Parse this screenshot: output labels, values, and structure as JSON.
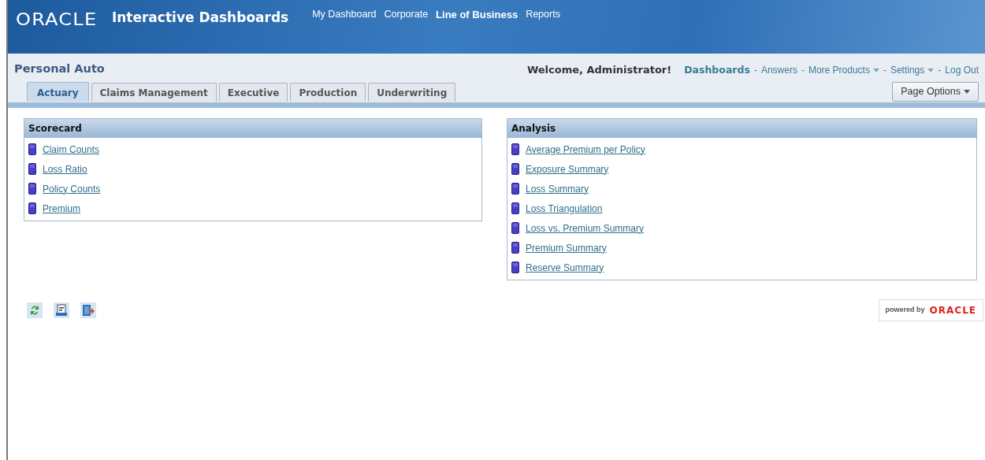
{
  "header": {
    "brand": "ORACLE",
    "app_title": "Interactive Dashboards",
    "nav": [
      {
        "label": "My Dashboard",
        "selected": false
      },
      {
        "label": "Corporate",
        "selected": false
      },
      {
        "label": "Line of Business",
        "selected": true
      },
      {
        "label": "Reports",
        "selected": false
      }
    ]
  },
  "page_title": "Personal Auto",
  "welcome": "Welcome, Administrator!",
  "global_links": [
    {
      "kind": "link",
      "label": "Dashboards",
      "selected": true,
      "has_menu": false
    },
    {
      "kind": "separator",
      "label": "-"
    },
    {
      "kind": "link",
      "label": "Answers",
      "selected": false,
      "has_menu": false
    },
    {
      "kind": "separator",
      "label": "-"
    },
    {
      "kind": "link",
      "label": "More Products",
      "selected": false,
      "has_menu": true
    },
    {
      "kind": "separator",
      "label": "-"
    },
    {
      "kind": "link",
      "label": "Settings",
      "selected": false,
      "has_menu": true
    },
    {
      "kind": "separator",
      "label": "-"
    },
    {
      "kind": "link",
      "label": "Log Out",
      "selected": false,
      "has_menu": false
    }
  ],
  "tabs": [
    {
      "label": "Actuary",
      "selected": true
    },
    {
      "label": "Claims Management",
      "selected": false
    },
    {
      "label": "Executive",
      "selected": false
    },
    {
      "label": "Production",
      "selected": false
    },
    {
      "label": "Underwriting",
      "selected": false
    }
  ],
  "page_options": "Page Options",
  "sections": [
    {
      "title": "Scorecard",
      "items": [
        "Claim Counts",
        "Loss Ratio",
        "Policy Counts",
        "Premium"
      ]
    },
    {
      "title": "Analysis",
      "items": [
        "Average Premium per Policy",
        "Exposure Summary",
        "Loss Summary",
        "Loss Triangulation",
        "Loss vs. Premium Summary",
        "Premium Summary",
        "Reserve Summary"
      ]
    }
  ],
  "powered_by": {
    "text": "powered by",
    "brand": "ORACLE"
  }
}
